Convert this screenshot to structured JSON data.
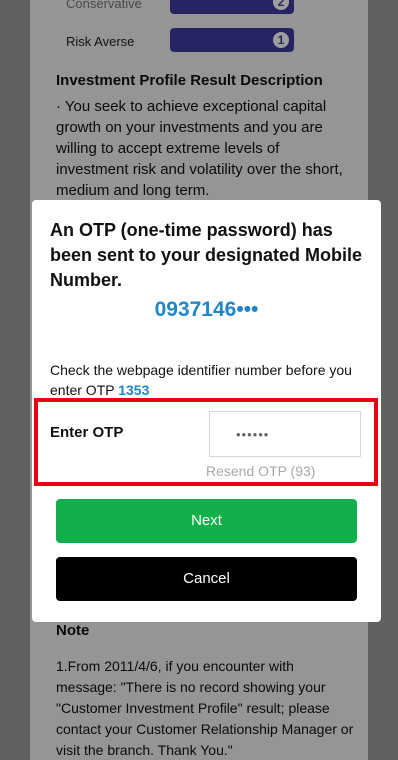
{
  "background": {
    "risk_profiles": [
      {
        "label": "Conservative",
        "badge": "2"
      },
      {
        "label": "Risk Averse",
        "badge": "1"
      }
    ],
    "result_title": "Investment Profile Result Description",
    "result_desc": "· You seek to achieve exceptional capital growth on your investments and you are willing to accept extreme levels of investment risk and volatility over the short, medium and long term.",
    "note_title": "Note",
    "note_text": "1.From 2011/4/6, if you encounter with message: \"There is no record showing your \"Customer Investment Profile\" result; please contact your Customer Relationship Manager or visit the branch. Thank You.\""
  },
  "modal": {
    "title": "An OTP (one-time password) has been sent to your designated Mobile Number.",
    "phone": "0937146•••",
    "identifier_text": "Check the webpage identifier number before you enter OTP ",
    "identifier_code": "1353",
    "otp_label": "Enter OTP",
    "otp_placeholder": "••••••",
    "resend": "Resend OTP (93)",
    "next_label": "Next",
    "cancel_label": "Cancel"
  },
  "colors": {
    "accent_blue": "#1f86c7",
    "next_green": "#11b04a",
    "highlight_red": "#e60012",
    "risk_bar": "#3f3ba0"
  }
}
